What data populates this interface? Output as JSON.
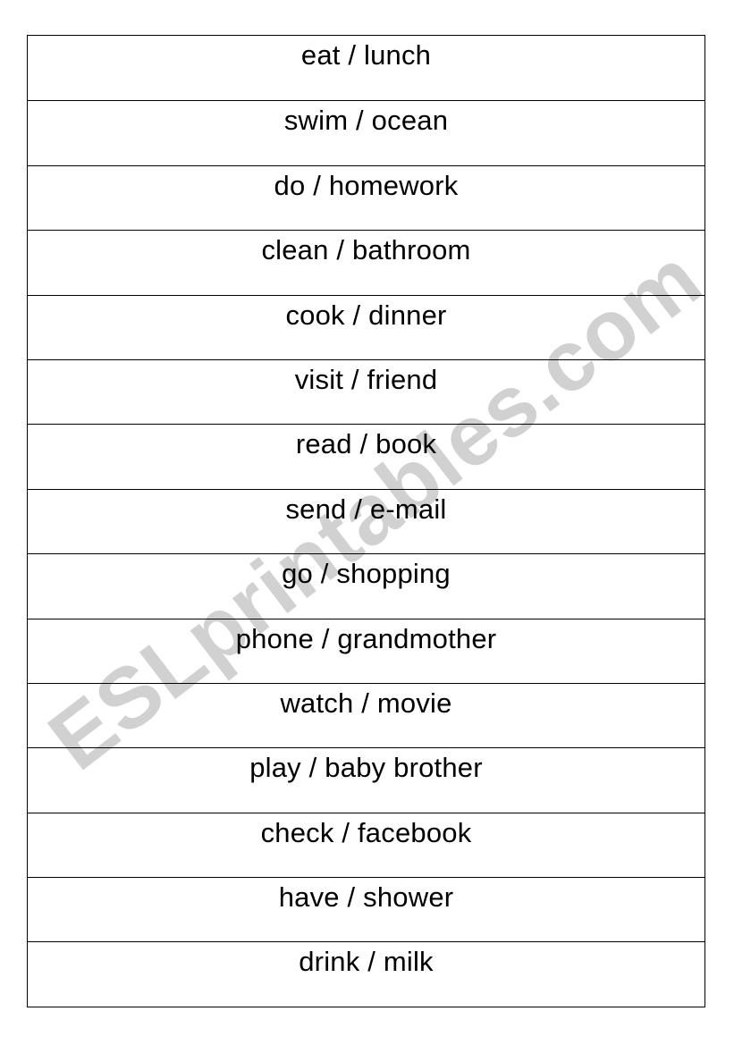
{
  "watermark": "ESLprintables.com",
  "rows": [
    {
      "text": "eat / lunch"
    },
    {
      "text": "swim / ocean"
    },
    {
      "text": "do / homework"
    },
    {
      "text": "clean / bathroom"
    },
    {
      "text": "cook / dinner"
    },
    {
      "text": "visit / friend"
    },
    {
      "text": "read / book"
    },
    {
      "text": "send / e-mail"
    },
    {
      "text": "go / shopping"
    },
    {
      "text": "phone / grandmother"
    },
    {
      "text": "watch / movie"
    },
    {
      "text": "play / baby brother"
    },
    {
      "text": "check / facebook"
    },
    {
      "text": "have / shower"
    },
    {
      "text": "drink / milk"
    }
  ],
  "colors": {
    "text": "#000000",
    "border": "#000000",
    "watermark": "#cfcfcf",
    "background": "#ffffff"
  }
}
